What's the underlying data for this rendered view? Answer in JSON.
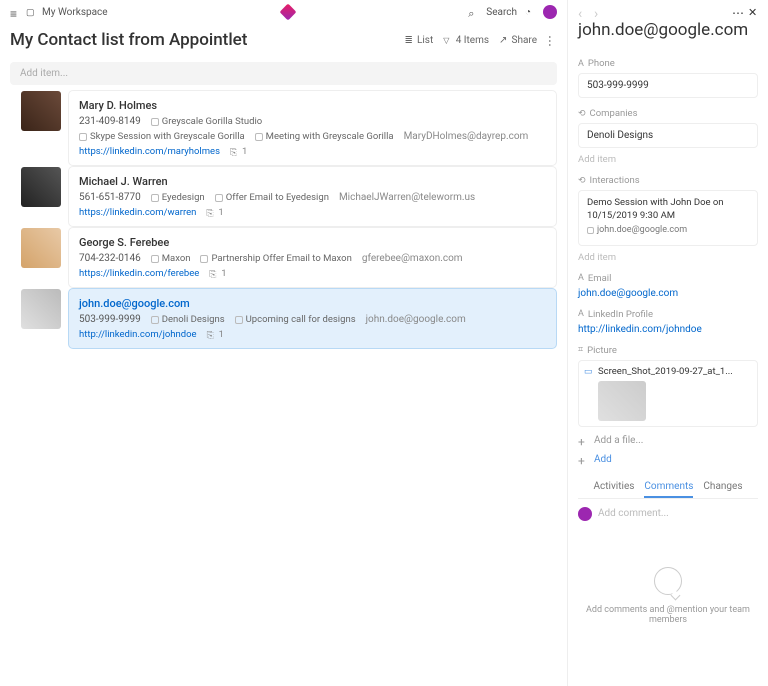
{
  "topbar": {
    "workspace": "My Workspace",
    "search": "Search"
  },
  "page": {
    "title": "My Contact list from Appointlet",
    "list_label": "List",
    "items_count": "4 Items",
    "share": "Share",
    "add_item_placeholder": "Add item..."
  },
  "contacts": [
    {
      "name": "Mary D. Holmes",
      "phone": "231-409-8149",
      "company": "Greyscale Gorilla Studio",
      "events": [
        "Skype Session with Greyscale Gorilla",
        "Meeting with Greyscale Gorilla"
      ],
      "email": "MaryDHolmes@dayrep.com",
      "linkedin": "https://linkedin.com/maryholmes",
      "badge": "1"
    },
    {
      "name": "Michael J. Warren",
      "phone": "561-651-8770",
      "company": "Eyedesign",
      "events": [
        "Offer Email to Eyedesign"
      ],
      "email": "MichaelJWarren@teleworm.us",
      "linkedin": "https://linkedin.com/warren",
      "badge": "1"
    },
    {
      "name": "George S. Ferebee",
      "phone": "704-232-0146",
      "company": "Maxon",
      "events": [
        "Partnership Offer Email to Maxon"
      ],
      "email": "gferebee@maxon.com",
      "linkedin": "https://linkedin.com/ferebee",
      "badge": "1"
    },
    {
      "name": "john.doe@google.com",
      "phone": "503-999-9999",
      "company": "Denoli Designs",
      "events": [
        "Upcoming call for designs"
      ],
      "email": "john.doe@google.com",
      "linkedin": "http://linkedin.com/johndoe",
      "badge": "1"
    }
  ],
  "detail": {
    "title": "john.doe@google.com",
    "labels": {
      "phone": "Phone",
      "companies": "Companies",
      "interactions": "Interactions",
      "email": "Email",
      "linkedin": "LinkedIn Profile",
      "picture": "Picture"
    },
    "phone": "503-999-9999",
    "company": "Denoli Designs",
    "interaction": "Demo Session with John Doe on 10/15/2019 9:30 AM",
    "interaction_sub": "john.doe@google.com",
    "email": "john.doe@google.com",
    "linkedin": "http://linkedin.com/johndoe",
    "picture_file": "Screen_Shot_2019-09-27_at_1...",
    "add_item": "Add item",
    "add_file": "Add a file...",
    "add": "Add",
    "tabs": {
      "activities": "Activities",
      "comments": "Comments",
      "changes": "Changes"
    },
    "comment_placeholder": "Add comment...",
    "empty": "Add comments and @mention your team members"
  }
}
